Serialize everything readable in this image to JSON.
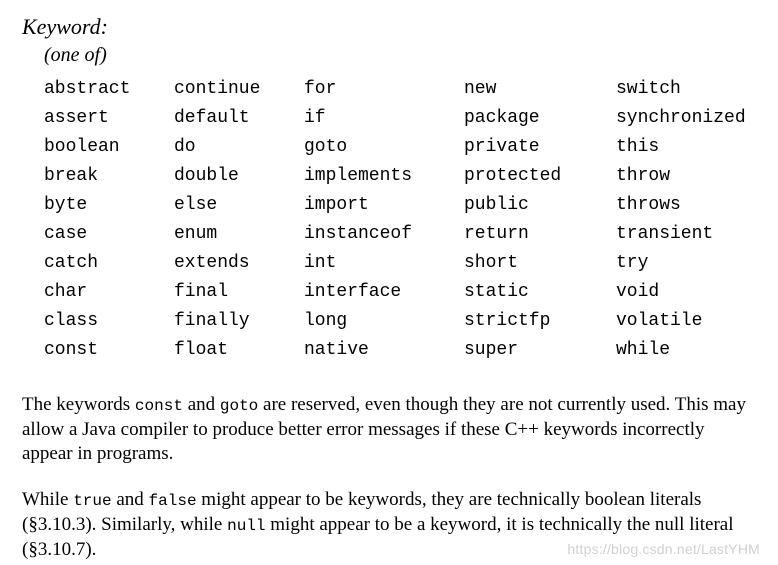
{
  "heading": {
    "title": "Keyword:",
    "subtitle": "(one of)"
  },
  "keywords": [
    [
      "abstract",
      "continue",
      "for",
      "new",
      "switch"
    ],
    [
      "assert",
      "default",
      "if",
      "package",
      "synchronized"
    ],
    [
      "boolean",
      "do",
      "goto",
      "private",
      "this"
    ],
    [
      "break",
      "double",
      "implements",
      "protected",
      "throw"
    ],
    [
      "byte",
      "else",
      "import",
      "public",
      "throws"
    ],
    [
      "case",
      "enum",
      "instanceof",
      "return",
      "transient"
    ],
    [
      "catch",
      "extends",
      "int",
      "short",
      "try"
    ],
    [
      "char",
      "final",
      "interface",
      "static",
      "void"
    ],
    [
      "class",
      "finally",
      "long",
      "strictfp",
      "volatile"
    ],
    [
      "const",
      "float",
      "native",
      "super",
      "while"
    ]
  ],
  "para1": {
    "t1": "The keywords ",
    "m1": "const",
    "t2": " and ",
    "m2": "goto",
    "t3": " are reserved, even though they are not currently used. This may allow a Java compiler to produce better error messages if these C++ keywords incorrectly appear in programs."
  },
  "para2": {
    "t1": "While ",
    "m1": "true",
    "t2": " and ",
    "m2": "false",
    "t3": " might appear to be keywords, they are technically boolean literals (§3.10.3). Similarly, while ",
    "m3": "null",
    "t4": " might appear to be a keyword, it is technically the null literal (§3.10.7)."
  },
  "watermark": "https://blog.csdn.net/LastYHM"
}
